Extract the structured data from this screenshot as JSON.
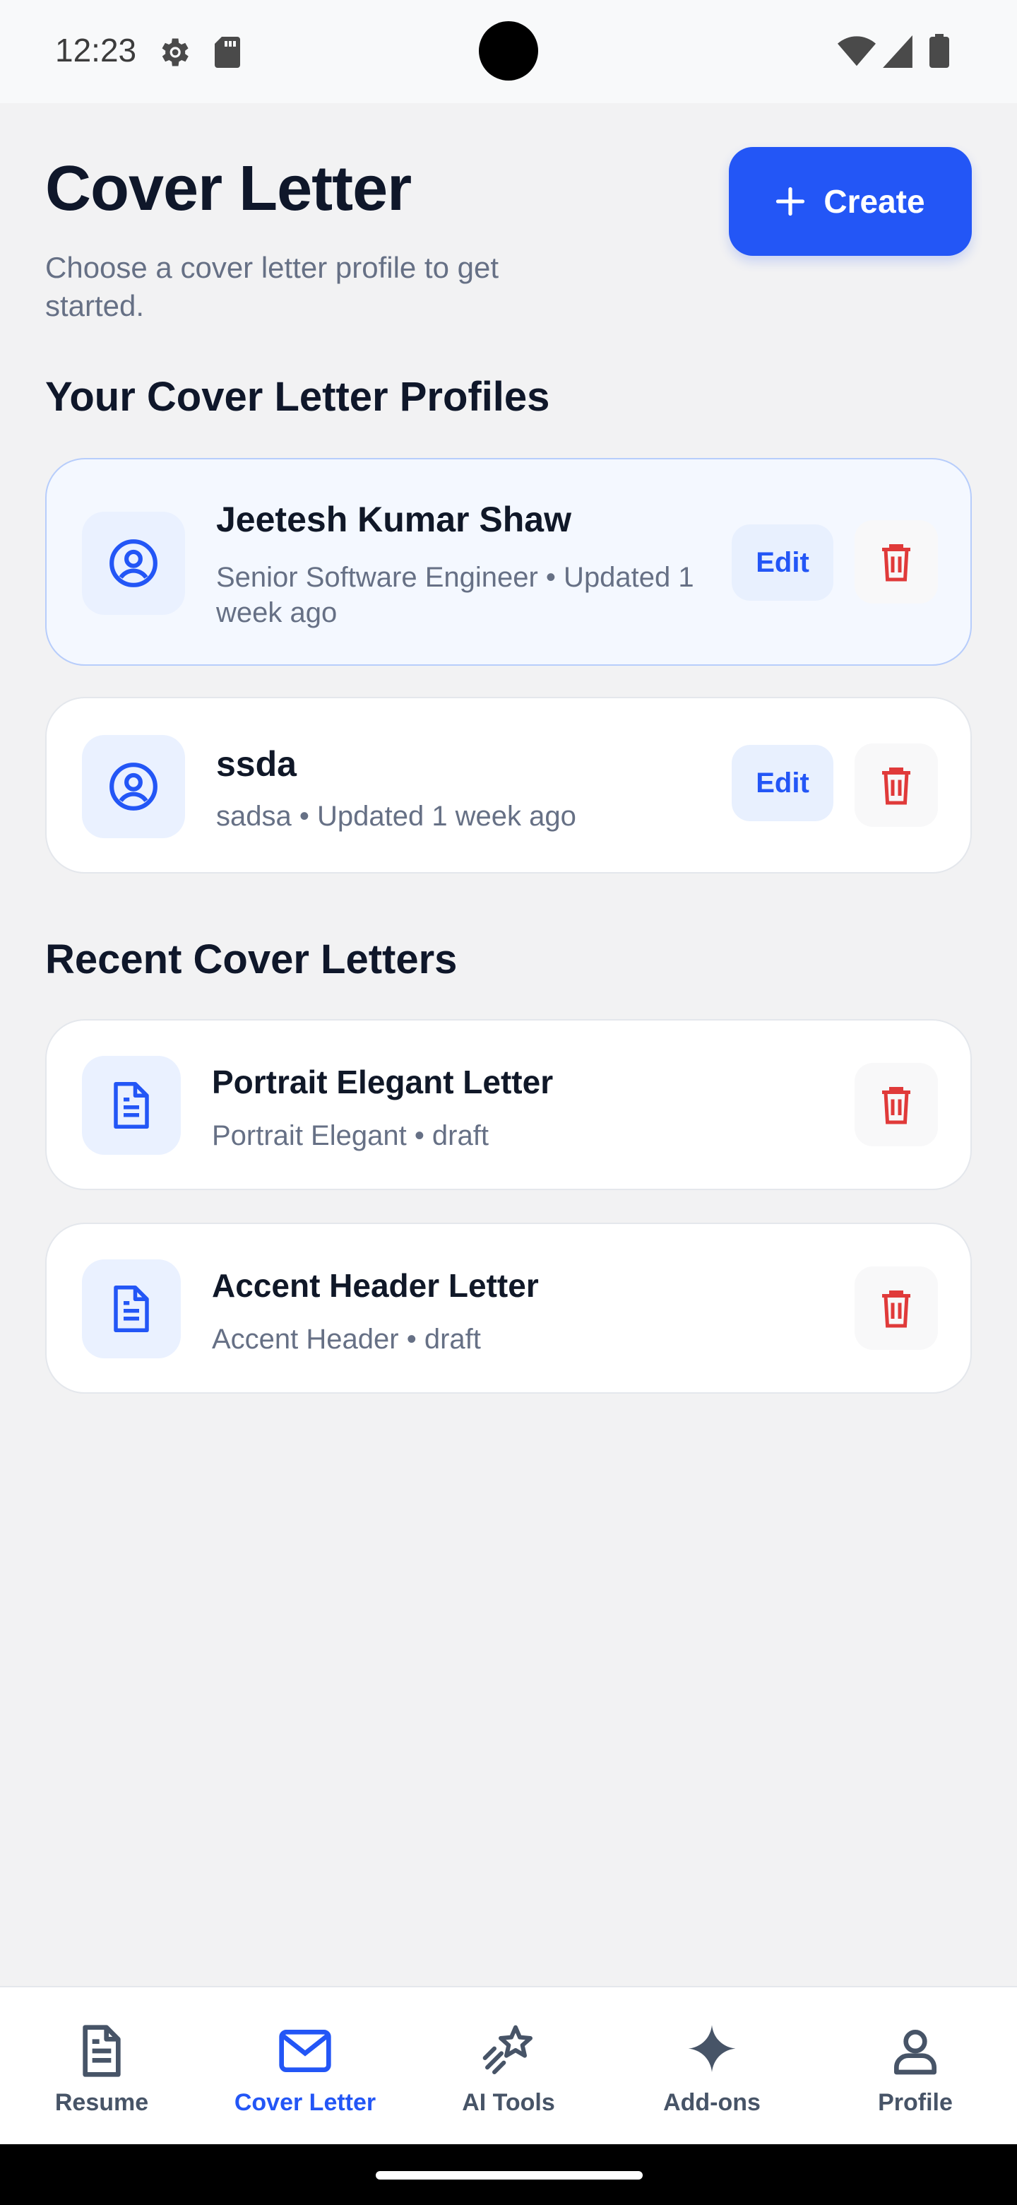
{
  "status_bar": {
    "time": "12:23",
    "icons": [
      "gear-icon",
      "sd-card-icon",
      "wifi-icon",
      "signal-icon",
      "battery-icon"
    ]
  },
  "header": {
    "title": "Cover Letter",
    "subtitle": "Choose a cover letter profile to get started.",
    "create_label": "Create"
  },
  "profiles_section": {
    "title": "Your Cover Letter Profiles",
    "items": [
      {
        "name": "Jeetesh Kumar Shaw",
        "meta": "Senior Software Engineer  • Updated 1 week ago",
        "edit_label": "Edit",
        "selected": true
      },
      {
        "name": "ssda",
        "meta": "sadsa • Updated 1 week ago",
        "edit_label": "Edit",
        "selected": false
      }
    ]
  },
  "recent_section": {
    "title": "Recent Cover Letters",
    "items": [
      {
        "name": "Portrait Elegant Letter",
        "meta": "Portrait Elegant • draft"
      },
      {
        "name": "Accent Header Letter",
        "meta": "Accent Header • draft"
      }
    ]
  },
  "bottom_nav": {
    "items": [
      {
        "label": "Resume",
        "icon": "document-icon",
        "active": false
      },
      {
        "label": "Cover Letter",
        "icon": "envelope-icon",
        "active": true
      },
      {
        "label": "AI Tools",
        "icon": "shooting-star-icon",
        "active": false
      },
      {
        "label": "Add-ons",
        "icon": "sparkle-icon",
        "active": false
      },
      {
        "label": "Profile",
        "icon": "person-icon",
        "active": false
      }
    ]
  },
  "colors": {
    "accent": "#2356f6",
    "background": "#f2f2f3",
    "danger": "#e03a3a",
    "muted_text": "#667085"
  }
}
